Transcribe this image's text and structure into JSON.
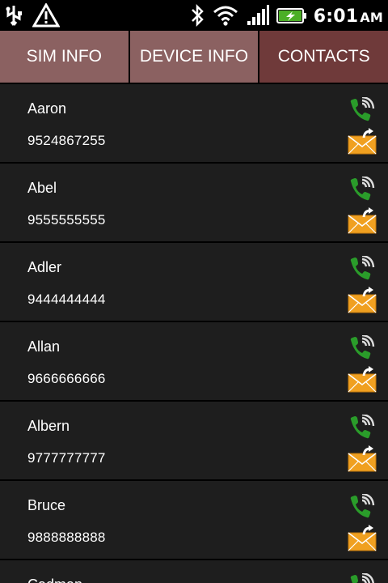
{
  "status": {
    "time": "6:01",
    "ampm": "AM"
  },
  "tabs": [
    {
      "label": "SIM INFO"
    },
    {
      "label": "DEVICE INFO"
    },
    {
      "label": "CONTACTS"
    }
  ],
  "contacts": [
    {
      "name": "Aaron",
      "number": "9524867255"
    },
    {
      "name": "Abel",
      "number": "9555555555"
    },
    {
      "name": "Adler",
      "number": "9444444444"
    },
    {
      "name": "Allan",
      "number": "9666666666"
    },
    {
      "name": "Albern",
      "number": "9777777777"
    },
    {
      "name": "Bruce",
      "number": "9888888888"
    },
    {
      "name": "Cadman",
      "number": ""
    }
  ],
  "colors": {
    "tab_inactive": "#8b6161",
    "tab_active": "#6f3a3a",
    "row_bg": "#1e1e1e",
    "call_green": "#2a9c2a",
    "mail_orange": "#f0a020"
  }
}
